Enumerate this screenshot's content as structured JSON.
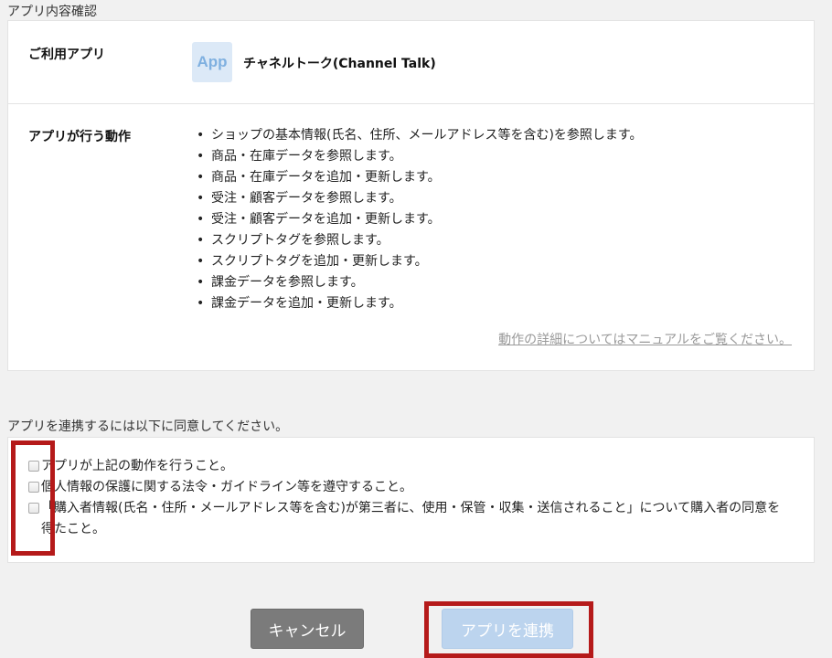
{
  "page": {
    "heading": "アプリ内容確認"
  },
  "app_row": {
    "label": "ご利用アプリ",
    "icon_text": "App",
    "app_name": "チャネルトーク(Channel Talk)"
  },
  "actions_row": {
    "label": "アプリが行う動作",
    "items": [
      "ショップの基本情報(氏名、住所、メールアドレス等を含む)を参照します。",
      "商品・在庫データを参照します。",
      "商品・在庫データを追加・更新します。",
      "受注・顧客データを参照します。",
      "受注・顧客データを追加・更新します。",
      "スクリプトタグを参照します。",
      "スクリプトタグを追加・更新します。",
      "課金データを参照します。",
      "課金データを追加・更新します。"
    ],
    "manual_link": "動作の詳細についてはマニュアルをご覧ください。"
  },
  "agreement": {
    "heading": "アプリを連携するには以下に同意してください。",
    "items": [
      "アプリが上記の動作を行うこと。",
      "個人情報の保護に関する法令・ガイドライン等を遵守すること。",
      "「購入者情報(氏名・住所・メールアドレス等を含む)が第三者に、使用・保管・収集・送信されること」について購入者の同意を得たこと。"
    ]
  },
  "buttons": {
    "cancel": "キャンセル",
    "connect": "アプリを連携"
  },
  "colors": {
    "highlight": "#b51a1a",
    "connect_button": "#bcd4ee",
    "cancel_button": "#7b7b7b",
    "app_icon_bg": "#dce9f7"
  }
}
